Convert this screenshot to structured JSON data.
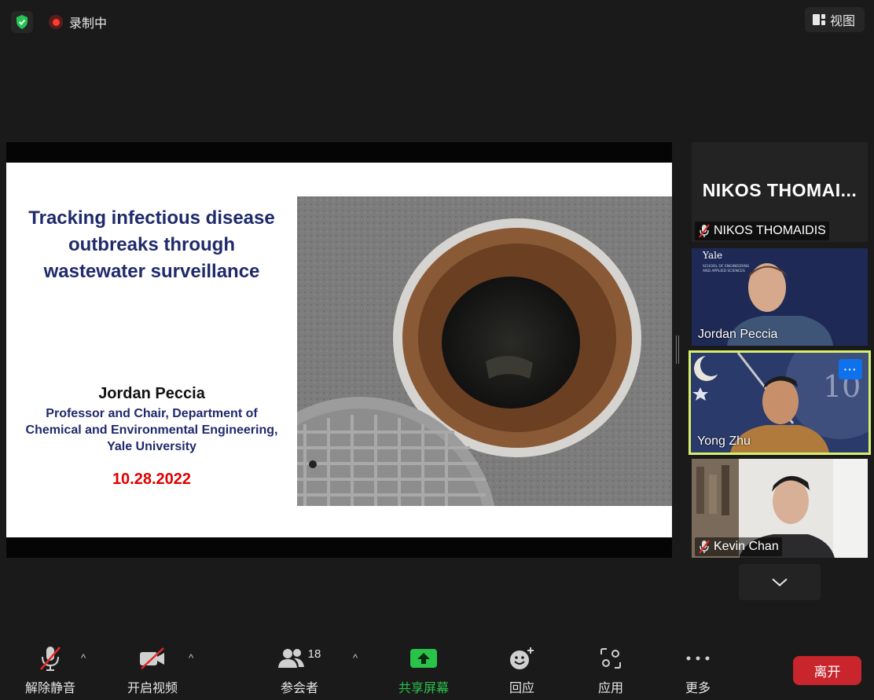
{
  "top_bar": {
    "recording_label": "录制中",
    "view_label": "视图"
  },
  "slide": {
    "title_lines": [
      "Tracking infectious disease",
      "outbreaks through",
      "wastewater surveillance"
    ],
    "author": "Jordan Peccia",
    "affiliation_lines": [
      "Professor and Chair, Department of",
      "Chemical and Environmental Engineering,",
      "Yale University"
    ],
    "date": "10.28.2022"
  },
  "participants": [
    {
      "name": "NIKOS THOMAIDIS",
      "big_name": "NIKOS  THOMAI...",
      "muted": true
    },
    {
      "name": "Jordan Peccia",
      "muted": false,
      "background_text": [
        "Yale",
        "SCHOOL OF ENGINEERING",
        "AND APPLIED SCIENCES"
      ]
    },
    {
      "name": "Yong Zhu",
      "muted": false,
      "active_speaker": true,
      "more_label": "···"
    },
    {
      "name": "Kevin Chan",
      "muted": true
    }
  ],
  "toolbar": {
    "unmute_label": "解除静音",
    "video_label": "开启视频",
    "participants_label": "参会者",
    "participants_count": "18",
    "share_label": "共享屏幕",
    "reactions_label": "回应",
    "apps_label": "应用",
    "more_label": "更多",
    "leave_label": "离开"
  },
  "colors": {
    "background": "#1a1a1a",
    "slide_title": "#1f2a6b",
    "slide_date": "#e00000",
    "share_green": "#29c34a",
    "leave_red": "#c8252c",
    "active_speaker_border": "#d8ef6c",
    "more_button_blue": "#0e72ed"
  }
}
